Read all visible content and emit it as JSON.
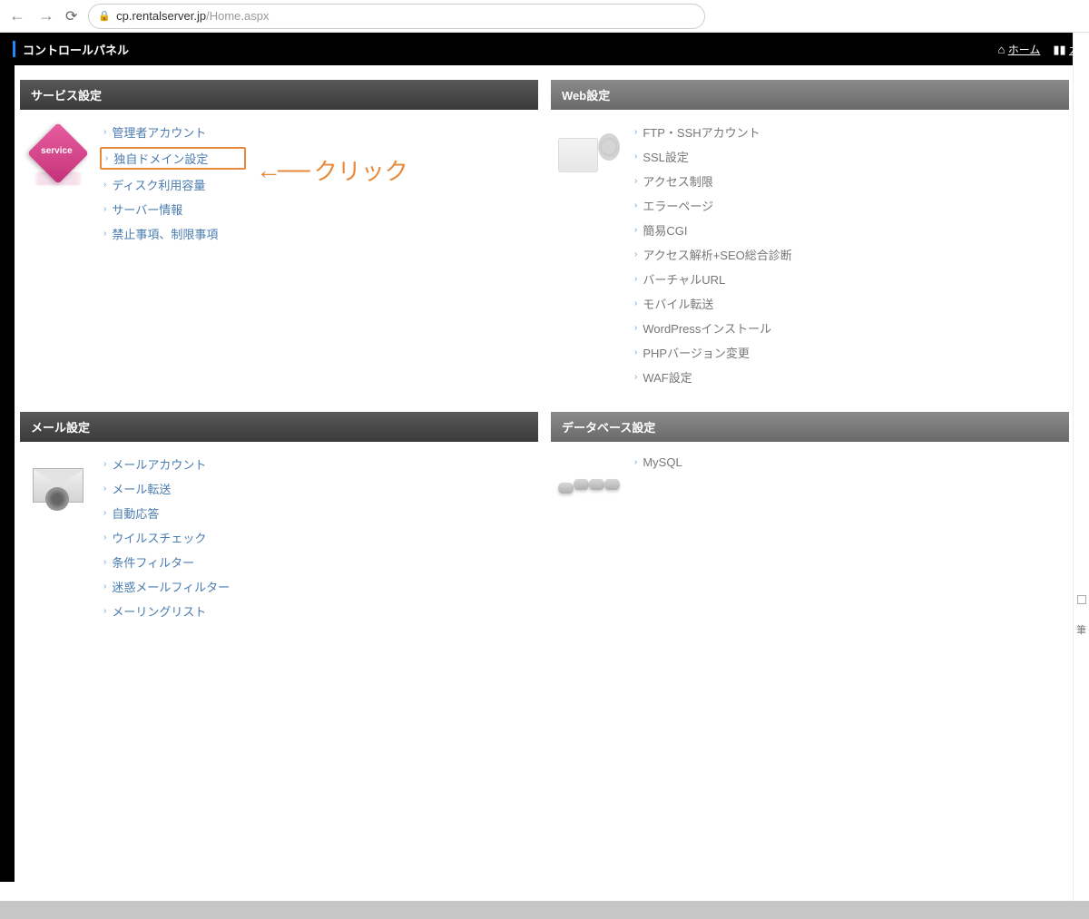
{
  "browser": {
    "url_domain": "cp.rentalserver.jp",
    "url_path": "/Home.aspx"
  },
  "header": {
    "title": "コントロールパネル",
    "home_link": "ホーム",
    "guide_link": "ガ"
  },
  "panels": {
    "service": {
      "title": "サービス設定",
      "links": [
        "管理者アカウント",
        "独自ドメイン設定",
        "ディスク利用容量",
        "サーバー情報",
        "禁止事項、制限事項"
      ]
    },
    "web": {
      "title": "Web設定",
      "links": [
        "FTP・SSHアカウント",
        "SSL設定",
        "アクセス制限",
        "エラーページ",
        "簡易CGI",
        "アクセス解析+SEO総合診断",
        "バーチャルURL",
        "モバイル転送",
        "WordPressインストール",
        "PHPバージョン変更",
        "WAF設定"
      ]
    },
    "mail": {
      "title": "メール設定",
      "links": [
        "メールアカウント",
        "メール転送",
        "自動応答",
        "ウイルスチェック",
        "条件フィルター",
        "迷惑メールフィルター",
        "メーリングリスト"
      ]
    },
    "db": {
      "title": "データベース設定",
      "links": [
        "MySQL"
      ]
    }
  },
  "annotation": {
    "text": "クリック"
  },
  "side": {
    "char": "筆"
  }
}
